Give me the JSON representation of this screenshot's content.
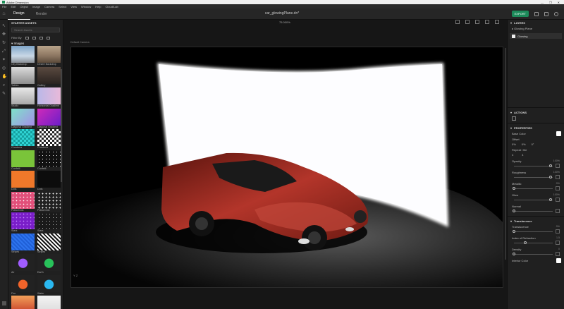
{
  "window": {
    "title": "Adobe Dimension",
    "controls": [
      "—",
      "❐",
      "✕"
    ]
  },
  "menu": [
    "File",
    "Edit",
    "Object",
    "Image",
    "Camera",
    "Select",
    "View",
    "Window",
    "Help",
    "Cloud/Lab"
  ],
  "header": {
    "tabs": [
      {
        "label": "Design",
        "active": true
      },
      {
        "label": "Render",
        "active": false
      }
    ],
    "document_title": "car_glowingPlane.dn*",
    "export_label": "EXPORT"
  },
  "canvas": {
    "zoom_label": "75.000%",
    "viewport_label": "Default Camera",
    "axis_label": "Y  Z"
  },
  "assets": {
    "panel_title": "STARTER ASSETS",
    "search_placeholder": "Search Assets",
    "filter_label": "Filter By",
    "section_title": "Images",
    "items": [
      {
        "label": "City Backdrop",
        "thumb": "city"
      },
      {
        "label": "Desert Backdrop",
        "thumb": "desert"
      },
      {
        "label": "Tables",
        "thumb": "table1"
      },
      {
        "label": "Gallery",
        "thumb": "gallery"
      },
      {
        "label": "Studio",
        "thumb": "studio"
      },
      {
        "label": "Horizontal Gradient",
        "thumb": "hgrad"
      },
      {
        "label": "Diagonal Gradient",
        "thumb": "dgrad"
      },
      {
        "label": "Diagonal Gradient",
        "thumb": "pgrad"
      },
      {
        "label": "Checkers",
        "thumb": "checkcyan"
      },
      {
        "label": "Checkers",
        "thumb": "checkbw"
      },
      {
        "label": "Confetti",
        "thumb": "green"
      },
      {
        "label": "Confetti",
        "thumb": "confetti"
      },
      {
        "label": "Dots",
        "thumb": "orange"
      },
      {
        "label": "Dots",
        "thumb": "dark"
      },
      {
        "label": "Polka Dots",
        "thumb": "pinkdots"
      },
      {
        "label": "Polka Dots",
        "thumb": "whitedots"
      },
      {
        "label": "Stars",
        "thumb": "purple"
      },
      {
        "label": "Stars",
        "thumb": "darkdots"
      },
      {
        "label": "Stripes",
        "thumb": "blue"
      },
      {
        "label": "Stripes",
        "thumb": "stripes"
      },
      {
        "label": "Air",
        "thumb": "air"
      },
      {
        "label": "Earth",
        "thumb": "earth"
      },
      {
        "label": "Fire",
        "thumb": "fire"
      },
      {
        "label": "Water",
        "thumb": "water"
      },
      {
        "label": "",
        "thumb": "sunset"
      },
      {
        "label": "",
        "thumb": "logo"
      }
    ]
  },
  "right_panel": {
    "layers_title": "LAYERS",
    "layers_group": "Glowing Plane",
    "layer_item": "Glowing",
    "actions_title": "ACTIONS",
    "properties_title": "PROPERTIES",
    "base_color_label": "Base Color",
    "offset_label": "Offset",
    "offset_values": [
      "0%",
      "0%",
      "0°"
    ],
    "repeat_label": "Repeat / tile",
    "repeat_values": [
      "4",
      "4"
    ],
    "sliders": [
      {
        "label": "Opacity",
        "value": "100%",
        "pos": 1.0
      },
      {
        "label": "Roughness",
        "value": "100%",
        "pos": 1.0
      },
      {
        "label": "Metallic",
        "value": "0%",
        "pos": 0.0
      },
      {
        "label": "Glow",
        "value": "100%",
        "pos": 1.0
      },
      {
        "label": "Normal",
        "value": "",
        "pos": 0.0
      }
    ],
    "translucence_title": "Translucence",
    "translucence": {
      "label": "Translucence",
      "value": "0%",
      "pos": 0.0
    },
    "ior": {
      "label": "Index of Refraction",
      "value": "1.5",
      "pos": 0.3
    },
    "density": {
      "label": "Density",
      "value": "0",
      "pos": 0.0
    },
    "interior_color_label": "Interior Color"
  },
  "colors": {
    "accent": "#1c8a5a",
    "car_red": "#b3352a",
    "glow_plane": "#ffffff"
  }
}
